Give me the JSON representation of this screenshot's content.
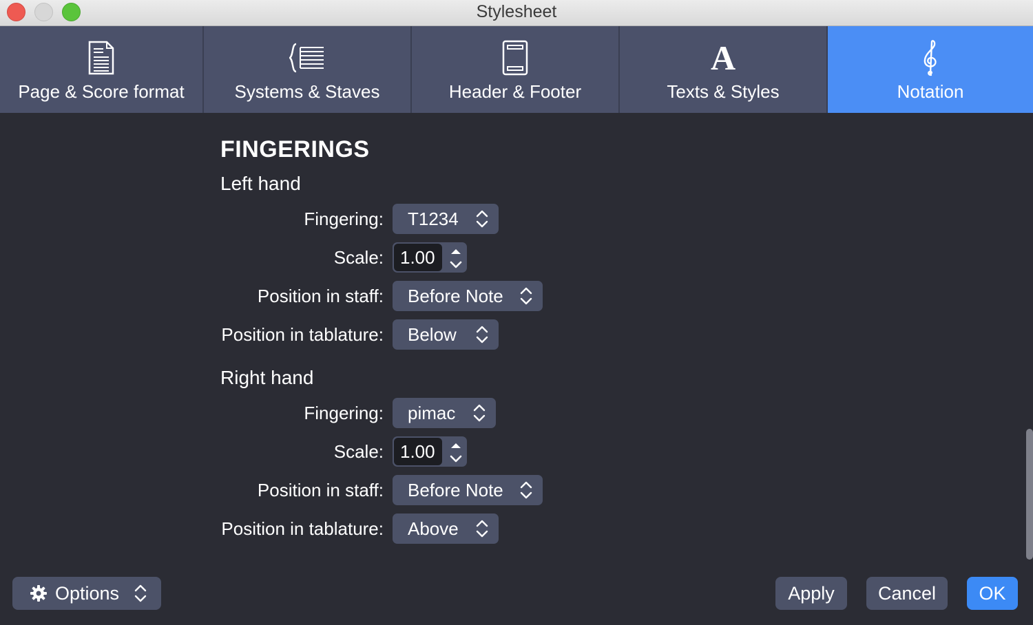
{
  "window": {
    "title": "Stylesheet"
  },
  "tabs": [
    {
      "label": "Page & Score format",
      "icon": "page-icon"
    },
    {
      "label": "Systems & Staves",
      "icon": "systems-icon"
    },
    {
      "label": "Header & Footer",
      "icon": "header-footer-icon"
    },
    {
      "label": "Texts & Styles",
      "icon": "text-a-icon"
    },
    {
      "label": "Notation",
      "icon": "treble-clef-icon",
      "active": true
    }
  ],
  "section": {
    "title": "FINGERINGS"
  },
  "left_hand": {
    "heading": "Left hand",
    "fingering_label": "Fingering:",
    "fingering_value": "T1234",
    "scale_label": "Scale:",
    "scale_value": "1.00",
    "position_staff_label": "Position in staff:",
    "position_staff_value": "Before Note",
    "position_tab_label": "Position in tablature:",
    "position_tab_value": "Below"
  },
  "right_hand": {
    "heading": "Right hand",
    "fingering_label": "Fingering:",
    "fingering_value": "pimac",
    "scale_label": "Scale:",
    "scale_value": "1.00",
    "position_staff_label": "Position in staff:",
    "position_staff_value": "Before Note",
    "position_tab_label": "Position in tablature:",
    "position_tab_value": "Above"
  },
  "footer": {
    "options_label": "Options",
    "apply_label": "Apply",
    "cancel_label": "Cancel",
    "ok_label": "OK"
  },
  "colors": {
    "accent": "#4b8ef5",
    "background": "#2b2c34",
    "tab": "#4b516a",
    "control": "#4c5268"
  }
}
